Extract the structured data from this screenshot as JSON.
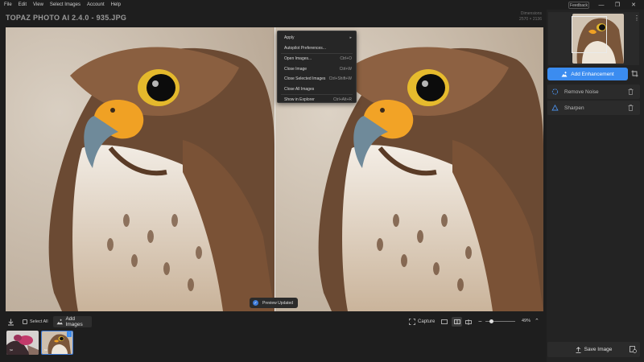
{
  "menu": [
    "File",
    "Edit",
    "View",
    "Select Images",
    "Account",
    "Help"
  ],
  "feedback_label": "Feedback",
  "app_title": "TOPAZ PHOTO AI 2.4.0 - 935.JPG",
  "dimensions": {
    "label": "Dimensions",
    "value": "2570 × 2136"
  },
  "context_menu": [
    {
      "label": "Apply",
      "shortcut": "▸"
    },
    {
      "label": "Autopilot Preferences...",
      "shortcut": ""
    },
    {
      "label": "Open Images...",
      "shortcut": "Ctrl+O"
    },
    {
      "label": "Close Image",
      "shortcut": "Ctrl+W"
    },
    {
      "label": "Close Selected Images",
      "shortcut": "Ctrl+Shift+W"
    },
    {
      "label": "Close All Images",
      "shortcut": ""
    },
    {
      "label": "Show in Explorer",
      "shortcut": "Ctrl+Alt+R"
    }
  ],
  "toast": "Preview Updated",
  "toolbar": {
    "select_all": "Select All",
    "add_images": "Add Images",
    "capture": "Capture",
    "zoom": "49%",
    "zoom_fraction": 0.2
  },
  "sidebar": {
    "add_enhancement": "Add Enhancement",
    "filters": [
      "Remove Noise",
      "Sharpen"
    ],
    "save_image": "Save Image"
  },
  "colors": {
    "accent": "#3b8cf0",
    "background": "#1e1e1e",
    "panel": "#2b2b2b"
  }
}
